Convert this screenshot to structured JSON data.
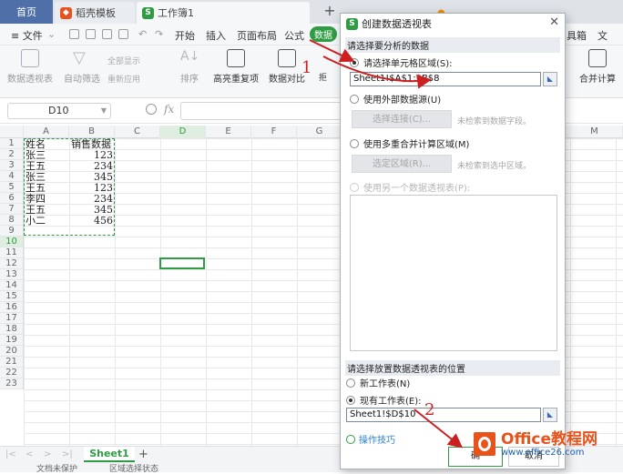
{
  "tabs": {
    "home": "首页",
    "daoke": "稻壳模板",
    "workbook": "工作簿1"
  },
  "menu": {
    "file": "≡ 文件",
    "start": "开始",
    "insert": "插入",
    "layout": "页面布局",
    "formula": "公式",
    "data": "数据",
    "right_tool": "具箱",
    "right_text": "文"
  },
  "ribbon": {
    "pivot": "数据透视表",
    "autofilter": "自动筛选",
    "show_all": "全部显示",
    "reapply": "重新应用",
    "sort": "排序",
    "highlight_dup": "高亮重复项",
    "data_compare": "数据对比",
    "reject": "拒",
    "merge_calc": "合并计算"
  },
  "formula_bar": {
    "name_box": "D10",
    "fx": "fx"
  },
  "grid": {
    "columns": [
      "A",
      "B",
      "C",
      "D",
      "E",
      "F",
      "G",
      "M"
    ],
    "rows": [
      "1",
      "2",
      "3",
      "4",
      "5",
      "6",
      "7",
      "8",
      "9",
      "10",
      "11",
      "12",
      "13",
      "14",
      "15",
      "16",
      "17",
      "18",
      "19",
      "20",
      "21",
      "22",
      "23"
    ],
    "headers": [
      "姓名",
      "销售数据"
    ],
    "data": [
      [
        "张三",
        "123"
      ],
      [
        "王五",
        "234"
      ],
      [
        "张三",
        "345"
      ],
      [
        "王五",
        "123"
      ],
      [
        "李四",
        "234"
      ],
      [
        "王五",
        "345"
      ],
      [
        "小二",
        "456"
      ]
    ]
  },
  "sheet_tabs": {
    "sheet1": "Sheet1",
    "add": "+"
  },
  "status": {
    "left": "文档未保护",
    "mid": "区域选择状态"
  },
  "dialog": {
    "title": "创建数据透视表",
    "section_source": "请选择要分析的数据",
    "opt_range": "请选择单元格区域(S):",
    "range_value": "Sheet1!$A$1:$B$8",
    "opt_external": "使用外部数据源(U)",
    "btn_connect": "选择连接(C)...",
    "note_no_field": "未检索到数据字段。",
    "opt_multi": "使用多重合并计算区域(M)",
    "btn_select_region": "选定区域(R)...",
    "note_no_region": "未检索到选中区域。",
    "opt_other_pivot": "使用另一个数据透视表(P):",
    "section_place": "请选择放置数据透视表的位置",
    "opt_new_sheet": "新工作表(N)",
    "opt_existing": "现有工作表(E):",
    "existing_value": "Sheet1!$D$10",
    "tips": "操作技巧",
    "ok": "确",
    "cancel": "取消"
  },
  "annotations": {
    "one": "1",
    "two": "2"
  },
  "watermark": {
    "title": "Office教程网",
    "url": "www.office26.com"
  },
  "colors": {
    "accent": "#2f9c44",
    "annotation": "#cc1f1f",
    "watermark_orange": "#e8531c"
  }
}
